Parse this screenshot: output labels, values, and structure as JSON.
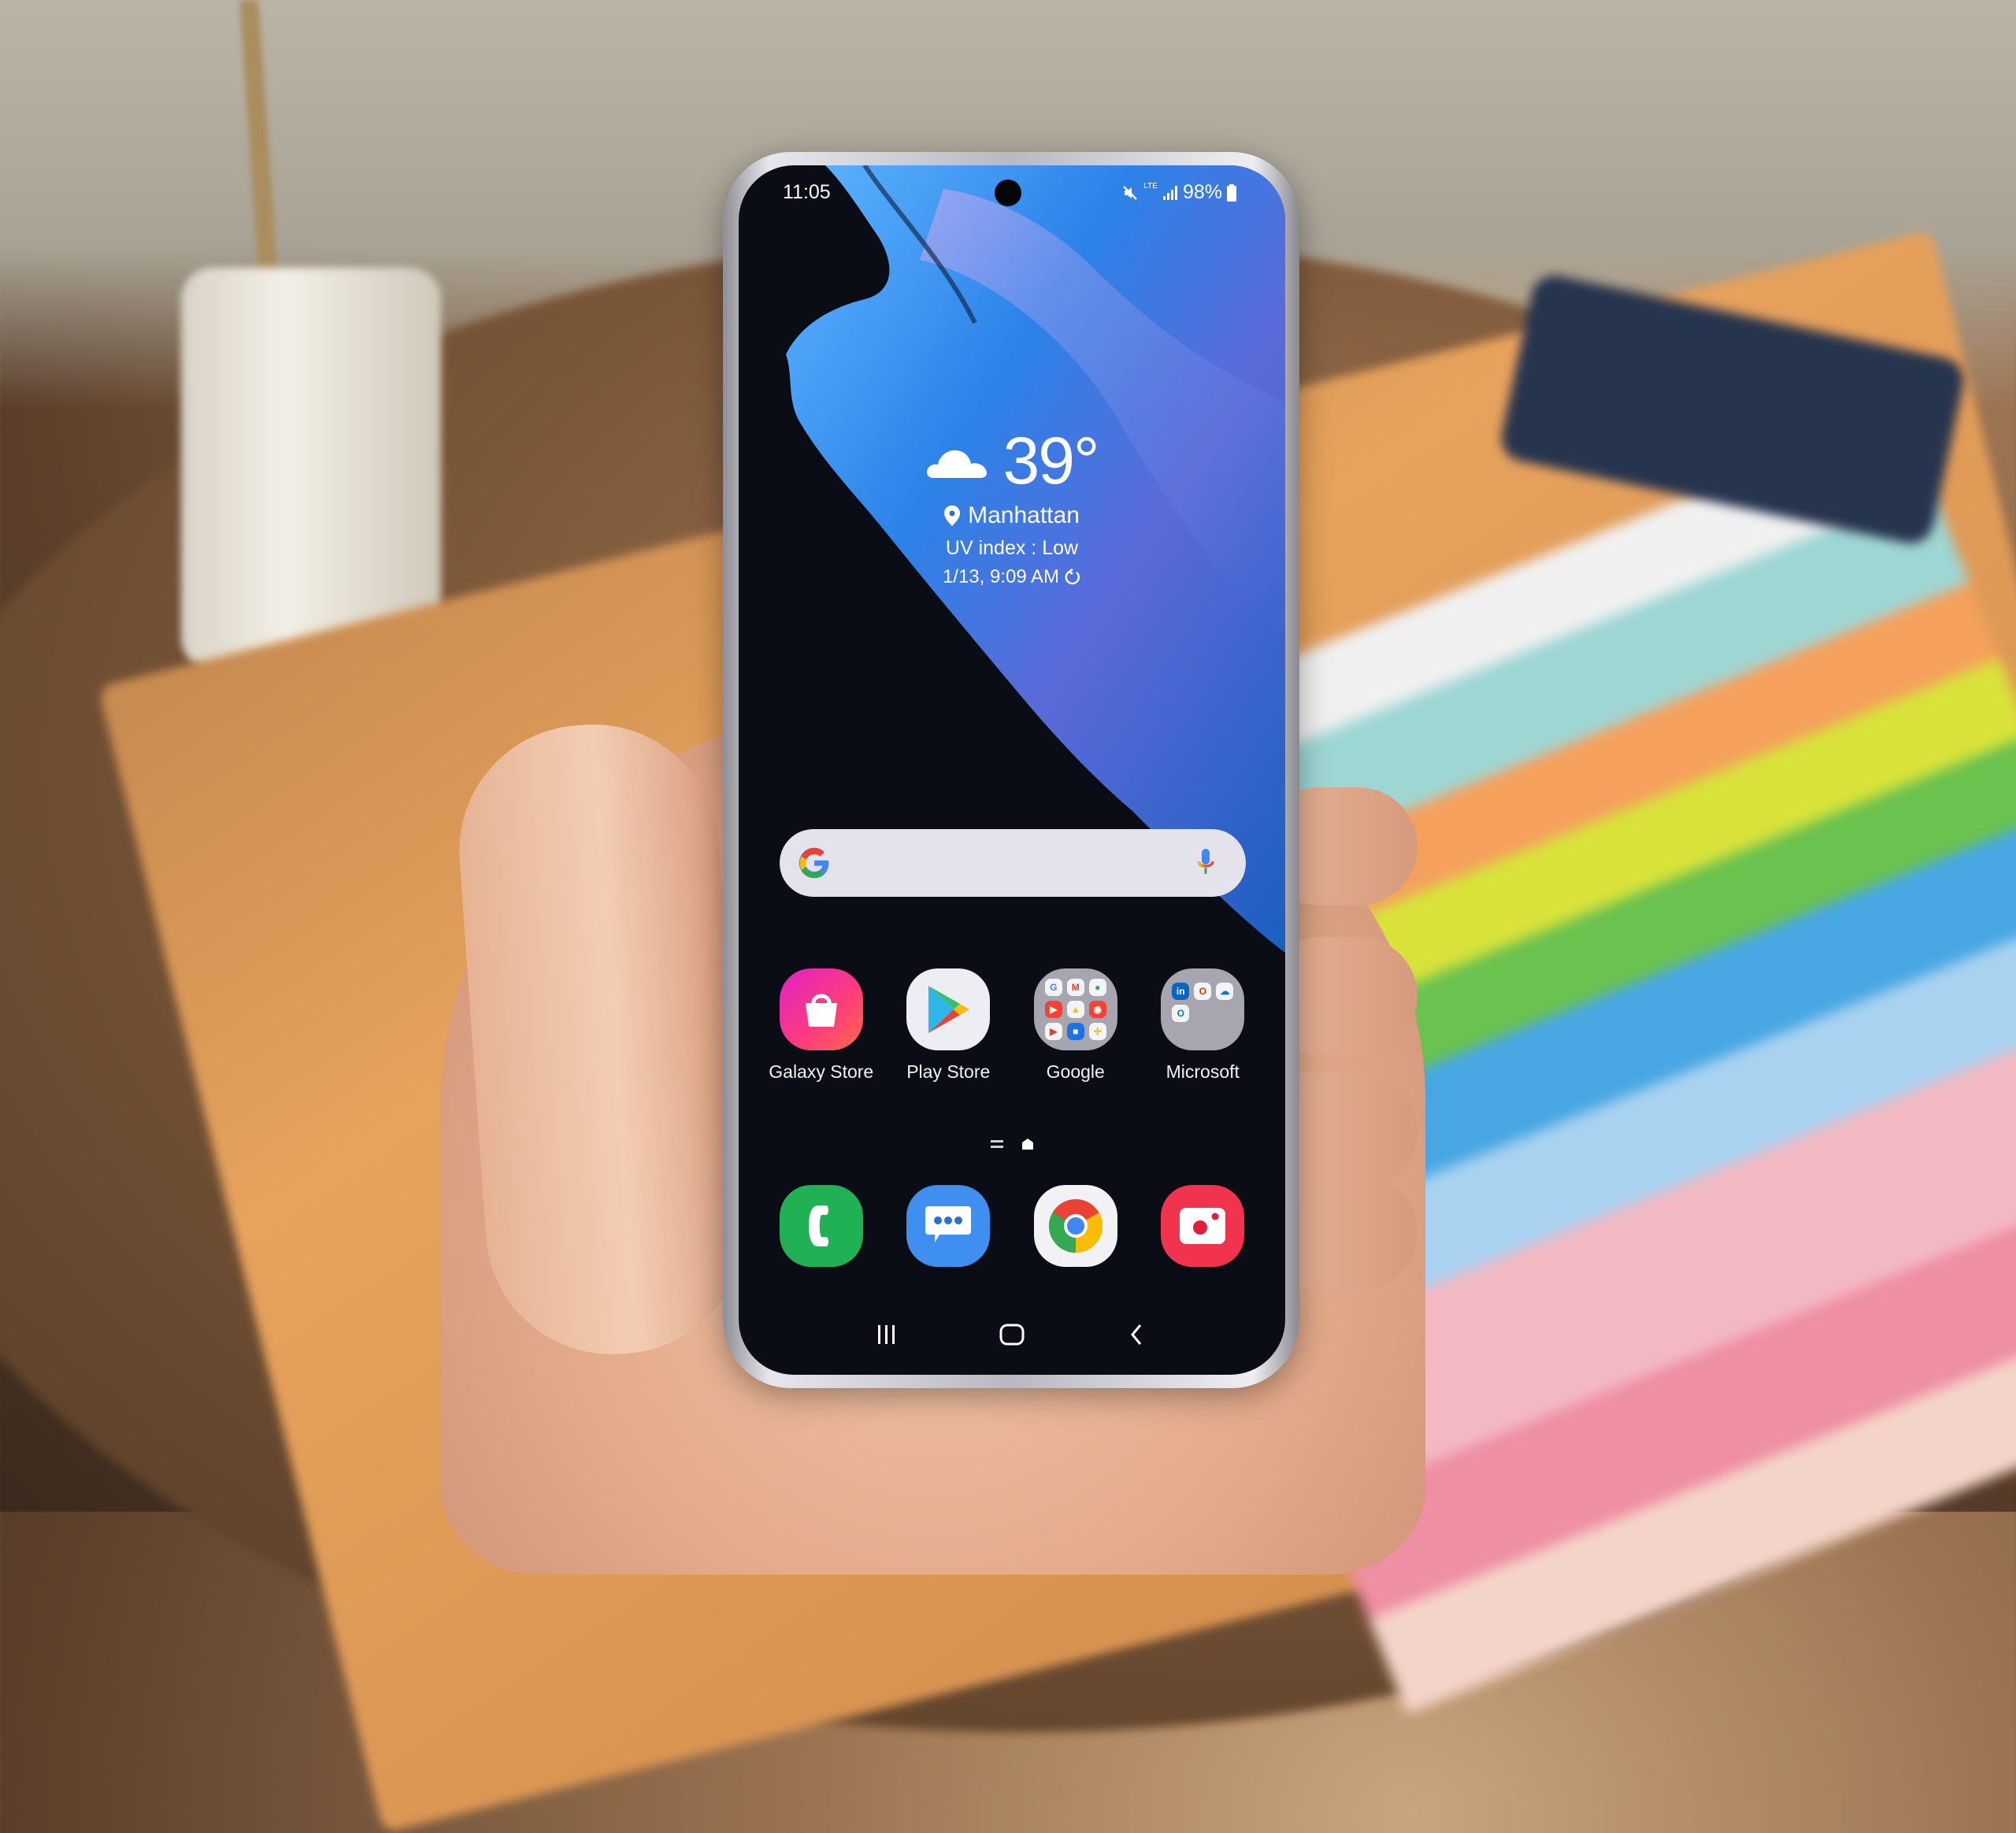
{
  "status_bar": {
    "time": "11:05",
    "network": "LTE",
    "battery": "98%",
    "icons": [
      "mute-icon",
      "signal-icon",
      "battery-icon"
    ]
  },
  "weather_widget": {
    "icon": "cloud-icon",
    "temperature": "39°",
    "location": "Manhattan",
    "uv": "UV index : Low",
    "updated": "1/13, 9:09 AM"
  },
  "search_bar": {
    "logo": "G",
    "mic_icon": "microphone-icon"
  },
  "home_apps": [
    {
      "label": "Galaxy Store",
      "icon": "galaxy-store-icon"
    },
    {
      "label": "Play Store",
      "icon": "play-store-icon"
    },
    {
      "label": "Google",
      "icon": "google-folder-icon"
    },
    {
      "label": "Microsoft",
      "icon": "microsoft-folder-icon"
    }
  ],
  "google_folder": [
    "G",
    "M",
    "Maps",
    "YouTube",
    "Drive",
    "YT Music",
    "Play Movies",
    "Duo",
    "Photos"
  ],
  "microsoft_folder": [
    "in",
    "Office",
    "OneDrive",
    "Outlook"
  ],
  "dock": [
    {
      "name": "Phone",
      "icon": "phone-icon",
      "color": "#1fb154"
    },
    {
      "name": "Messages",
      "icon": "messages-icon",
      "color": "#3e8ff0"
    },
    {
      "name": "Chrome",
      "icon": "chrome-icon",
      "color": "#f2f2f5"
    },
    {
      "name": "Camera",
      "icon": "camera-icon",
      "color": "#f2334d"
    }
  ],
  "nav_bar": {
    "recents": "recents-icon",
    "home": "home-icon",
    "back": "back-icon"
  },
  "colors": {
    "galaxy_store_gradient": [
      "#e022c8",
      "#ff4a64"
    ],
    "wallpaper_blue": "#2f86e6",
    "search_bg": "#e4e3ec"
  }
}
